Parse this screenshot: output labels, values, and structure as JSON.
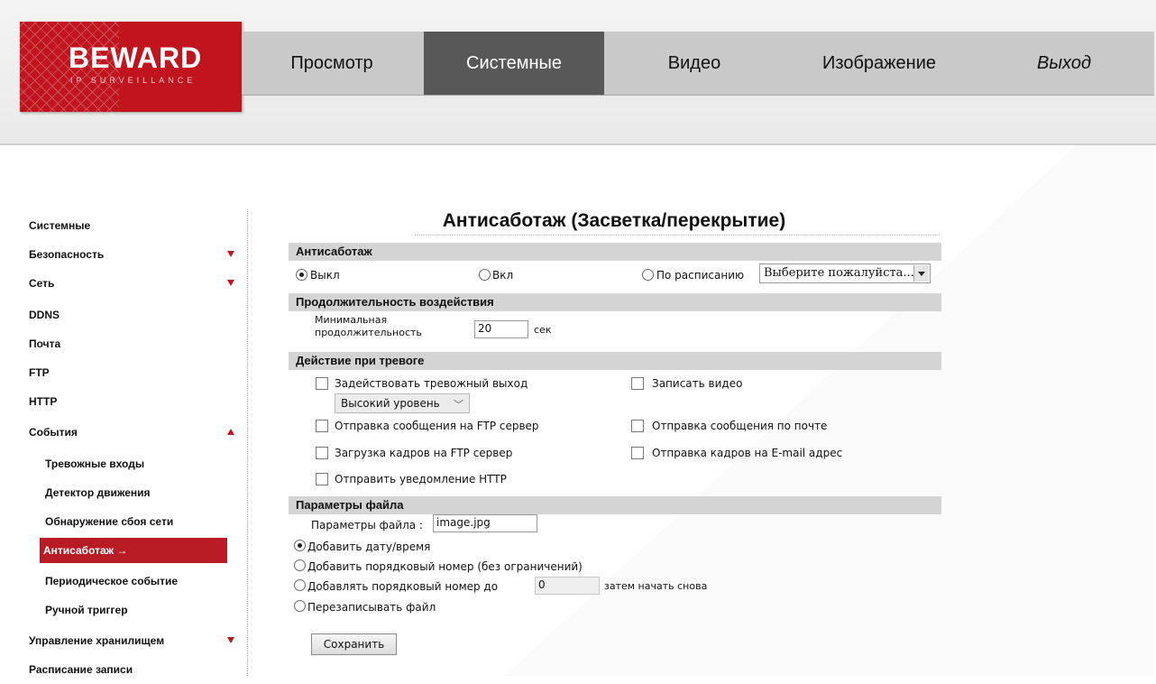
{
  "logo": {
    "brand": "BEWARD",
    "tagline": "IP SURVEILLANCE"
  },
  "nav": {
    "tabs": [
      {
        "label": "Просмотр"
      },
      {
        "label": "Системные"
      },
      {
        "label": "Видео"
      },
      {
        "label": "Изображение"
      },
      {
        "label": "Выход"
      }
    ],
    "active": "Системные"
  },
  "sidebar": {
    "items": [
      {
        "label": "Системные"
      },
      {
        "label": "Безопасность",
        "arrow": "down"
      },
      {
        "label": "Сеть",
        "arrow": "down"
      },
      {
        "label": "DDNS"
      },
      {
        "label": "Почта"
      },
      {
        "label": "FTP"
      },
      {
        "label": "HTTP"
      },
      {
        "label": "События",
        "arrow": "up"
      },
      {
        "label": "Тревожные входы"
      },
      {
        "label": "Детектор движения"
      },
      {
        "label": "Обнаружение сбоя сети"
      },
      {
        "label": "Антисаботаж",
        "active": true
      },
      {
        "label": "Периодическое событие"
      },
      {
        "label": "Ручной триггер"
      },
      {
        "label": "Управление хранилищем",
        "arrow": "down"
      },
      {
        "label": "Расписание записи"
      }
    ],
    "active_marker": "→"
  },
  "page": {
    "title": "Антисаботаж (Засветка/перекрытие)"
  },
  "antisabotage": {
    "header": "Антисаботаж",
    "opt_off": "Выкл",
    "opt_on": "Вкл",
    "opt_schedule": "По расписанию",
    "selected": "Выкл",
    "schedule_placeholder": "Выберите пожалуйста..."
  },
  "duration": {
    "header": "Продолжительность воздействия",
    "label_line1": "Минимальная",
    "label_line2": "продолжительность",
    "value": "20",
    "unit": "сек"
  },
  "alarm_action": {
    "header": "Действие при тревоге",
    "alarm_output": "Задействовать тревожный выход",
    "level": "Высокий уровень",
    "record_video": "Записать видео",
    "ftp_message": "Отправка сообщения на FTP сервер",
    "email_message": "Отправка сообщения по почте",
    "ftp_upload": "Загрузка кадров на FTP сервер",
    "email_frames": "Отправка кадров на E-mail адрес",
    "http_notify": "Отправить уведомление HTTP"
  },
  "file_params": {
    "header": "Параметры файла",
    "label": "Параметры файла :",
    "filename": "image.jpg",
    "opt_datetime": "Добавить дату/время",
    "opt_seq_unlimited": "Добавить порядковый номер (без ограничений)",
    "opt_seq_to": "Добавлять порядковый номер до",
    "seq_to_value": "0",
    "seq_then": "затем начать снова",
    "opt_overwrite": "Перезаписывать файл",
    "selected": "Добавить дату/время"
  },
  "save_label": "Сохранить",
  "colors": {
    "brand_red": "#c0141e",
    "active_tab": "#585858",
    "section_bg": "#d4d4d4",
    "sidebar_active": "#b71c25"
  }
}
